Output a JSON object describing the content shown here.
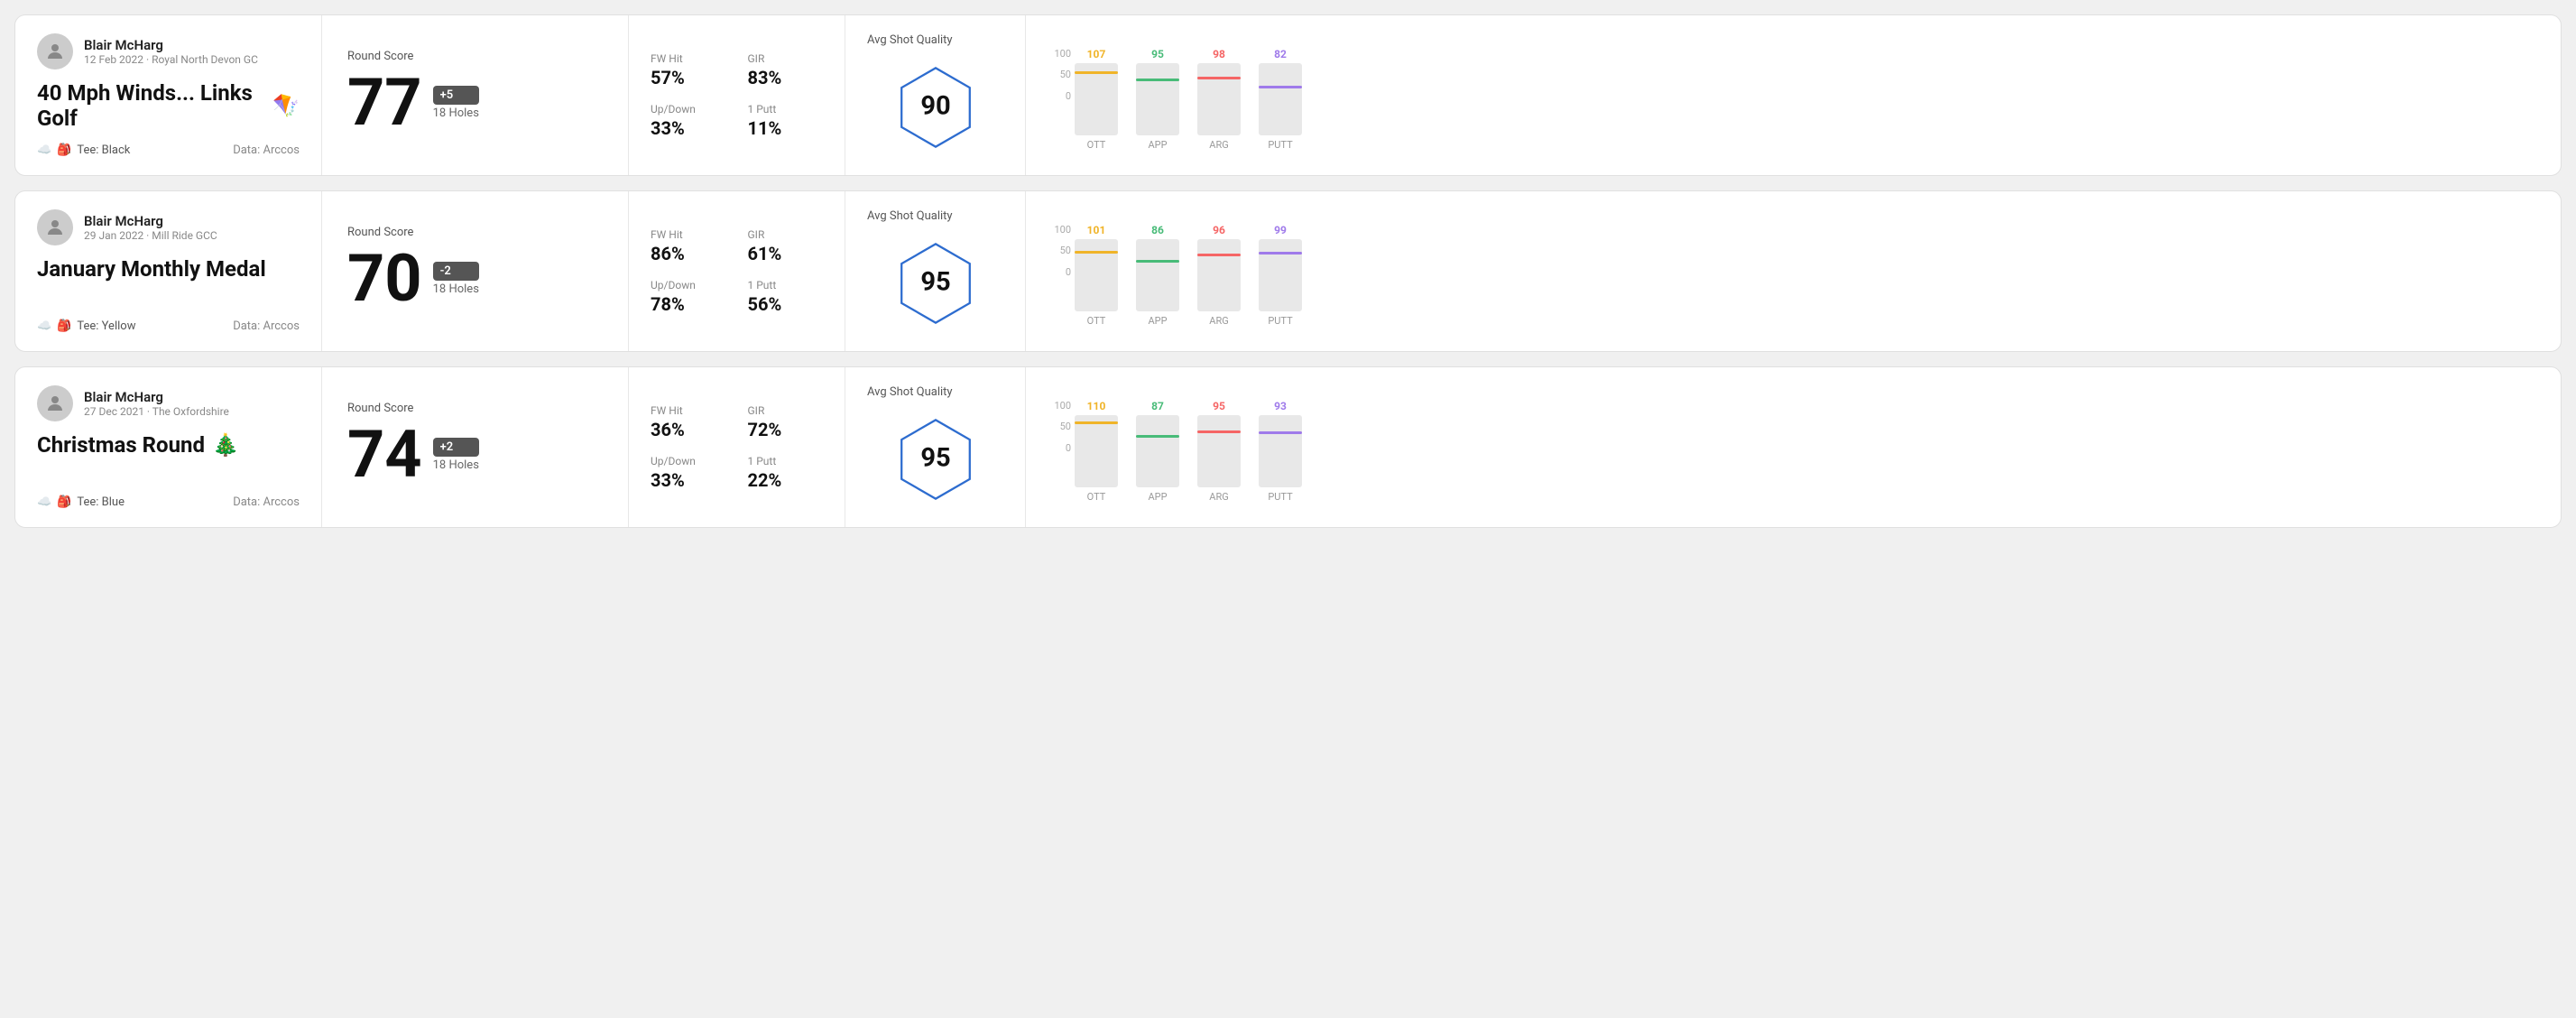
{
  "rounds": [
    {
      "id": "round1",
      "player_name": "Blair McHarg",
      "date": "12 Feb 2022 · Royal North Devon GC",
      "title": "40 Mph Winds... Links Golf",
      "title_emoji": "🪁",
      "tee": "Tee: Black",
      "data_source": "Data: Arccos",
      "round_score_label": "Round Score",
      "score": "77",
      "badge": "+5",
      "badge_sign": "positive",
      "holes": "18 Holes",
      "fw_hit_label": "FW Hit",
      "fw_hit": "57%",
      "gir_label": "GIR",
      "gir": "83%",
      "updown_label": "Up/Down",
      "updown": "33%",
      "oneputt_label": "1 Putt",
      "oneputt": "11%",
      "avg_quality_label": "Avg Shot Quality",
      "quality_score": "90",
      "chart": {
        "columns": [
          {
            "label": "OTT",
            "value": 107,
            "color": "#f0b429"
          },
          {
            "label": "APP",
            "value": 95,
            "color": "#48bb78"
          },
          {
            "label": "ARG",
            "value": 98,
            "color": "#f56565"
          },
          {
            "label": "PUTT",
            "value": 82,
            "color": "#9f7aea"
          }
        ],
        "y_labels": [
          "100",
          "50",
          "0"
        ]
      }
    },
    {
      "id": "round2",
      "player_name": "Blair McHarg",
      "date": "29 Jan 2022 · Mill Ride GCC",
      "title": "January Monthly Medal",
      "title_emoji": "",
      "tee": "Tee: Yellow",
      "data_source": "Data: Arccos",
      "round_score_label": "Round Score",
      "score": "70",
      "badge": "-2",
      "badge_sign": "negative",
      "holes": "18 Holes",
      "fw_hit_label": "FW Hit",
      "fw_hit": "86%",
      "gir_label": "GIR",
      "gir": "61%",
      "updown_label": "Up/Down",
      "updown": "78%",
      "oneputt_label": "1 Putt",
      "oneputt": "56%",
      "avg_quality_label": "Avg Shot Quality",
      "quality_score": "95",
      "chart": {
        "columns": [
          {
            "label": "OTT",
            "value": 101,
            "color": "#f0b429"
          },
          {
            "label": "APP",
            "value": 86,
            "color": "#48bb78"
          },
          {
            "label": "ARG",
            "value": 96,
            "color": "#f56565"
          },
          {
            "label": "PUTT",
            "value": 99,
            "color": "#9f7aea"
          }
        ],
        "y_labels": [
          "100",
          "50",
          "0"
        ]
      }
    },
    {
      "id": "round3",
      "player_name": "Blair McHarg",
      "date": "27 Dec 2021 · The Oxfordshire",
      "title": "Christmas Round",
      "title_emoji": "🎄",
      "tee": "Tee: Blue",
      "data_source": "Data: Arccos",
      "round_score_label": "Round Score",
      "score": "74",
      "badge": "+2",
      "badge_sign": "positive",
      "holes": "18 Holes",
      "fw_hit_label": "FW Hit",
      "fw_hit": "36%",
      "gir_label": "GIR",
      "gir": "72%",
      "updown_label": "Up/Down",
      "updown": "33%",
      "oneputt_label": "1 Putt",
      "oneputt": "22%",
      "avg_quality_label": "Avg Shot Quality",
      "quality_score": "95",
      "chart": {
        "columns": [
          {
            "label": "OTT",
            "value": 110,
            "color": "#f0b429"
          },
          {
            "label": "APP",
            "value": 87,
            "color": "#48bb78"
          },
          {
            "label": "ARG",
            "value": 95,
            "color": "#f56565"
          },
          {
            "label": "PUTT",
            "value": 93,
            "color": "#9f7aea"
          }
        ],
        "y_labels": [
          "100",
          "50",
          "0"
        ]
      }
    }
  ]
}
